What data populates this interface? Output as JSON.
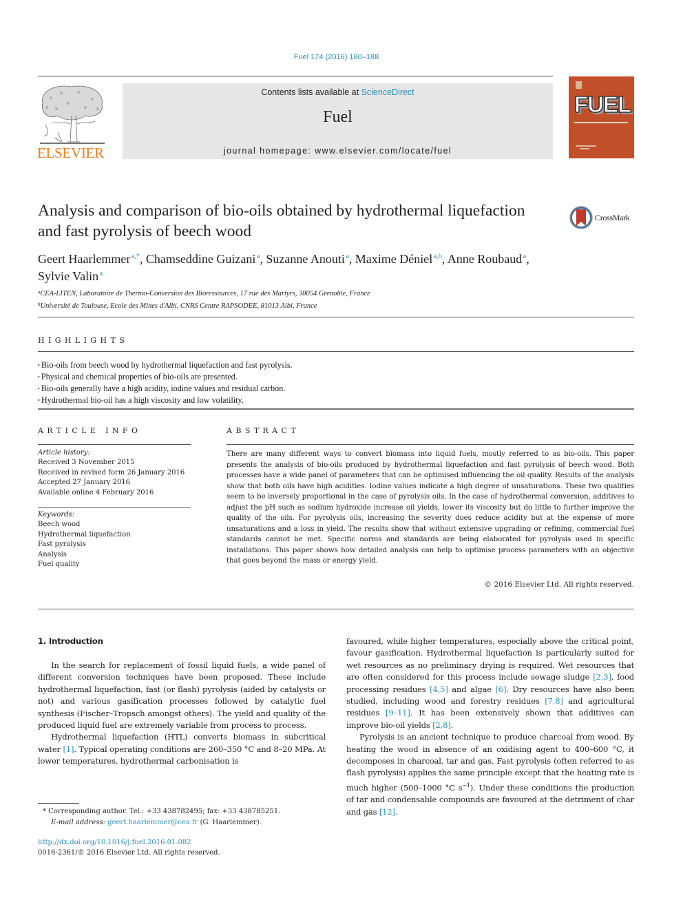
{
  "header": {
    "journal_reference": "Fuel 174 (2016) 180–188",
    "contents_prefix": "Contents lists available at ",
    "contents_link": "ScienceDirect",
    "journal_title": "Fuel",
    "homepage": "journal homepage: www.elsevier.com/locate/fuel",
    "publisher_logo": "ELSEVIER",
    "cover_title": "FUEL",
    "accent_color": "#2a8cb5",
    "publisher_color": "#f07d1b",
    "cover_color": "#c1502a"
  },
  "article": {
    "title": "Analysis and comparison of bio-oils obtained by hydrothermal liquefaction and fast pyrolysis of beech wood",
    "crossmark_label": "CrossMark",
    "authors": [
      {
        "name": "Geert Haarlemmer",
        "sup": "a,*",
        "sep": ", "
      },
      {
        "name": "Chamseddine Guizani",
        "sup": "a",
        "sep": ", "
      },
      {
        "name": "Suzanne Anouti",
        "sup": "a",
        "sep": ", "
      },
      {
        "name": "Maxime Déniel",
        "sup": "a,b",
        "sep": ", "
      },
      {
        "name": "Anne Roubaud",
        "sup": "a",
        "sep": ","
      },
      {
        "name": "Sylvie Valin",
        "sup": "a",
        "sep": ""
      }
    ],
    "affiliations": [
      {
        "key": "a",
        "text": "CEA-LITEN, Laboratoire de Thermo-Conversion des Bioressources, 17 rue des Martyrs, 38054 Grenoble, France"
      },
      {
        "key": "b",
        "text": "Université de Toulouse, Ecole des Mines d'Albi, CNRS Centre RAPSODEE, 81013 Albi, France"
      }
    ]
  },
  "highlights": {
    "heading": "HIGHLIGHTS",
    "items": [
      "Bio-oils from beech wood by hydrothermal liquefaction and fast pyrolysis.",
      "Physical and chemical properties of bio-oils are presented.",
      "Bio-oils generally have a high acidity, iodine values and residual carbon.",
      "Hydrothermal bio-oil has a high viscosity and low volatility."
    ]
  },
  "article_info": {
    "heading": "ARTICLE INFO",
    "history_label": "Article history:",
    "history": [
      "Received 3 November 2015",
      "Received in revised form 26 January 2016",
      "Accepted 27 January 2016",
      "Available online 4 February 2016"
    ],
    "keywords_label": "Keywords:",
    "keywords": [
      "Beech wood",
      "Hydrothermal liquefaction",
      "Fast pyrolysis",
      "Analysis",
      "Fuel quality"
    ]
  },
  "abstract": {
    "heading": "ABSTRACT",
    "text": "There are many different ways to convert biomass into liquid fuels, mostly referred to as bio-oils. This paper presents the analysis of bio-oils produced by hydrothermal liquefaction and fast pyrolysis of beech wood. Both processes have a wide panel of parameters that can be optimised influencing the oil quality. Results of the analysis show that both oils have high acidities. Iodine values indicate a high degree of unsaturations. These two qualities seem to be inversely proportional in the case of pyrolysis oils. In the case of hydrothermal conversion, additives to adjust the pH such as sodium hydroxide increase oil yields, lower its viscosity but do little to further improve the quality of the oils. For pyrolysis oils, increasing the severity does reduce acidity but at the expense of more unsaturations and a loss in yield. The results show that without extensive upgrading or refining, commercial fuel standards cannot be met. Specific norms and standards are being elaborated for pyrolysis used in specific installations. This paper shows how detailed analysis can help to optimise process parameters with an objective that goes beyond the mass or energy yield.",
    "copyright": "© 2016 Elsevier Ltd. All rights reserved."
  },
  "introduction": {
    "heading": "1. Introduction",
    "left_paragraphs": [
      [
        {
          "t": "In the search for replacement of fossil liquid fuels, a wide panel of different conversion techniques have been proposed. These include hydrothermal liquefaction, fast (or flash) pyrolysis (aided by catalysts or not) and various gasification processes followed by catalytic fuel synthesis (Fischer–Tropsch amongst others). The yield and quality of the produced liquid fuel are extremely variable from process to process."
        }
      ],
      [
        {
          "t": "Hydrothermal liquefaction (HTL) converts biomass in subcritical water "
        },
        {
          "ref": "[1]"
        },
        {
          "t": ". Typical operating conditions are 260–350 °C and 8–20 MPa. At lower temperatures, hydrothermal carbonisation is"
        }
      ]
    ],
    "right_paragraphs": [
      [
        {
          "t": "favoured, while higher temperatures, especially above the critical point, favour gasification. Hydrothermal liquefaction is particularly suited for wet resources as no preliminary drying is required. Wet resources that are often considered for this process include sewage sludge "
        },
        {
          "ref": "[2,3]"
        },
        {
          "t": ", food processing residues "
        },
        {
          "ref": "[4,5]"
        },
        {
          "t": " and algae "
        },
        {
          "ref": "[6]"
        },
        {
          "t": ". Dry resources have also been studied, including wood and forestry residues "
        },
        {
          "ref": "[7,8]"
        },
        {
          "t": " and agricultural residues "
        },
        {
          "ref": "[9–11]"
        },
        {
          "t": ". It has been extensively shown that additives can improve bio-oil yields "
        },
        {
          "ref": "[2,8]"
        },
        {
          "t": "."
        }
      ],
      [
        {
          "t": "Pyrolysis is an ancient technique to produce charcoal from wood. By heating the wood in absence of an oxidising agent to 400–600 °C, it decomposes in charcoal, tar and gas. Fast pyrolysis (often referred to as flash pyrolysis) applies the same principle except that the heating rate is much higher (500–1000 °C s"
        },
        {
          "sup": "−1"
        },
        {
          "t": "). Under these conditions the production of tar and condensable compounds are favoured at the detriment of char and gas "
        },
        {
          "ref": "[12]"
        },
        {
          "t": "."
        }
      ]
    ]
  },
  "footnotes": {
    "corresponding": "* Corresponding author. Tel.: +33 438782495; fax: +33 438785251.",
    "email_label": "E-mail address: ",
    "email": "geert.haarlemmer@cea.fr",
    "email_suffix": " (G. Haarlemmer).",
    "doi": "http://dx.doi.org/10.1016/j.fuel.2016.01.082",
    "issn_copyright": "0016-2361/© 2016 Elsevier Ltd. All rights reserved."
  }
}
